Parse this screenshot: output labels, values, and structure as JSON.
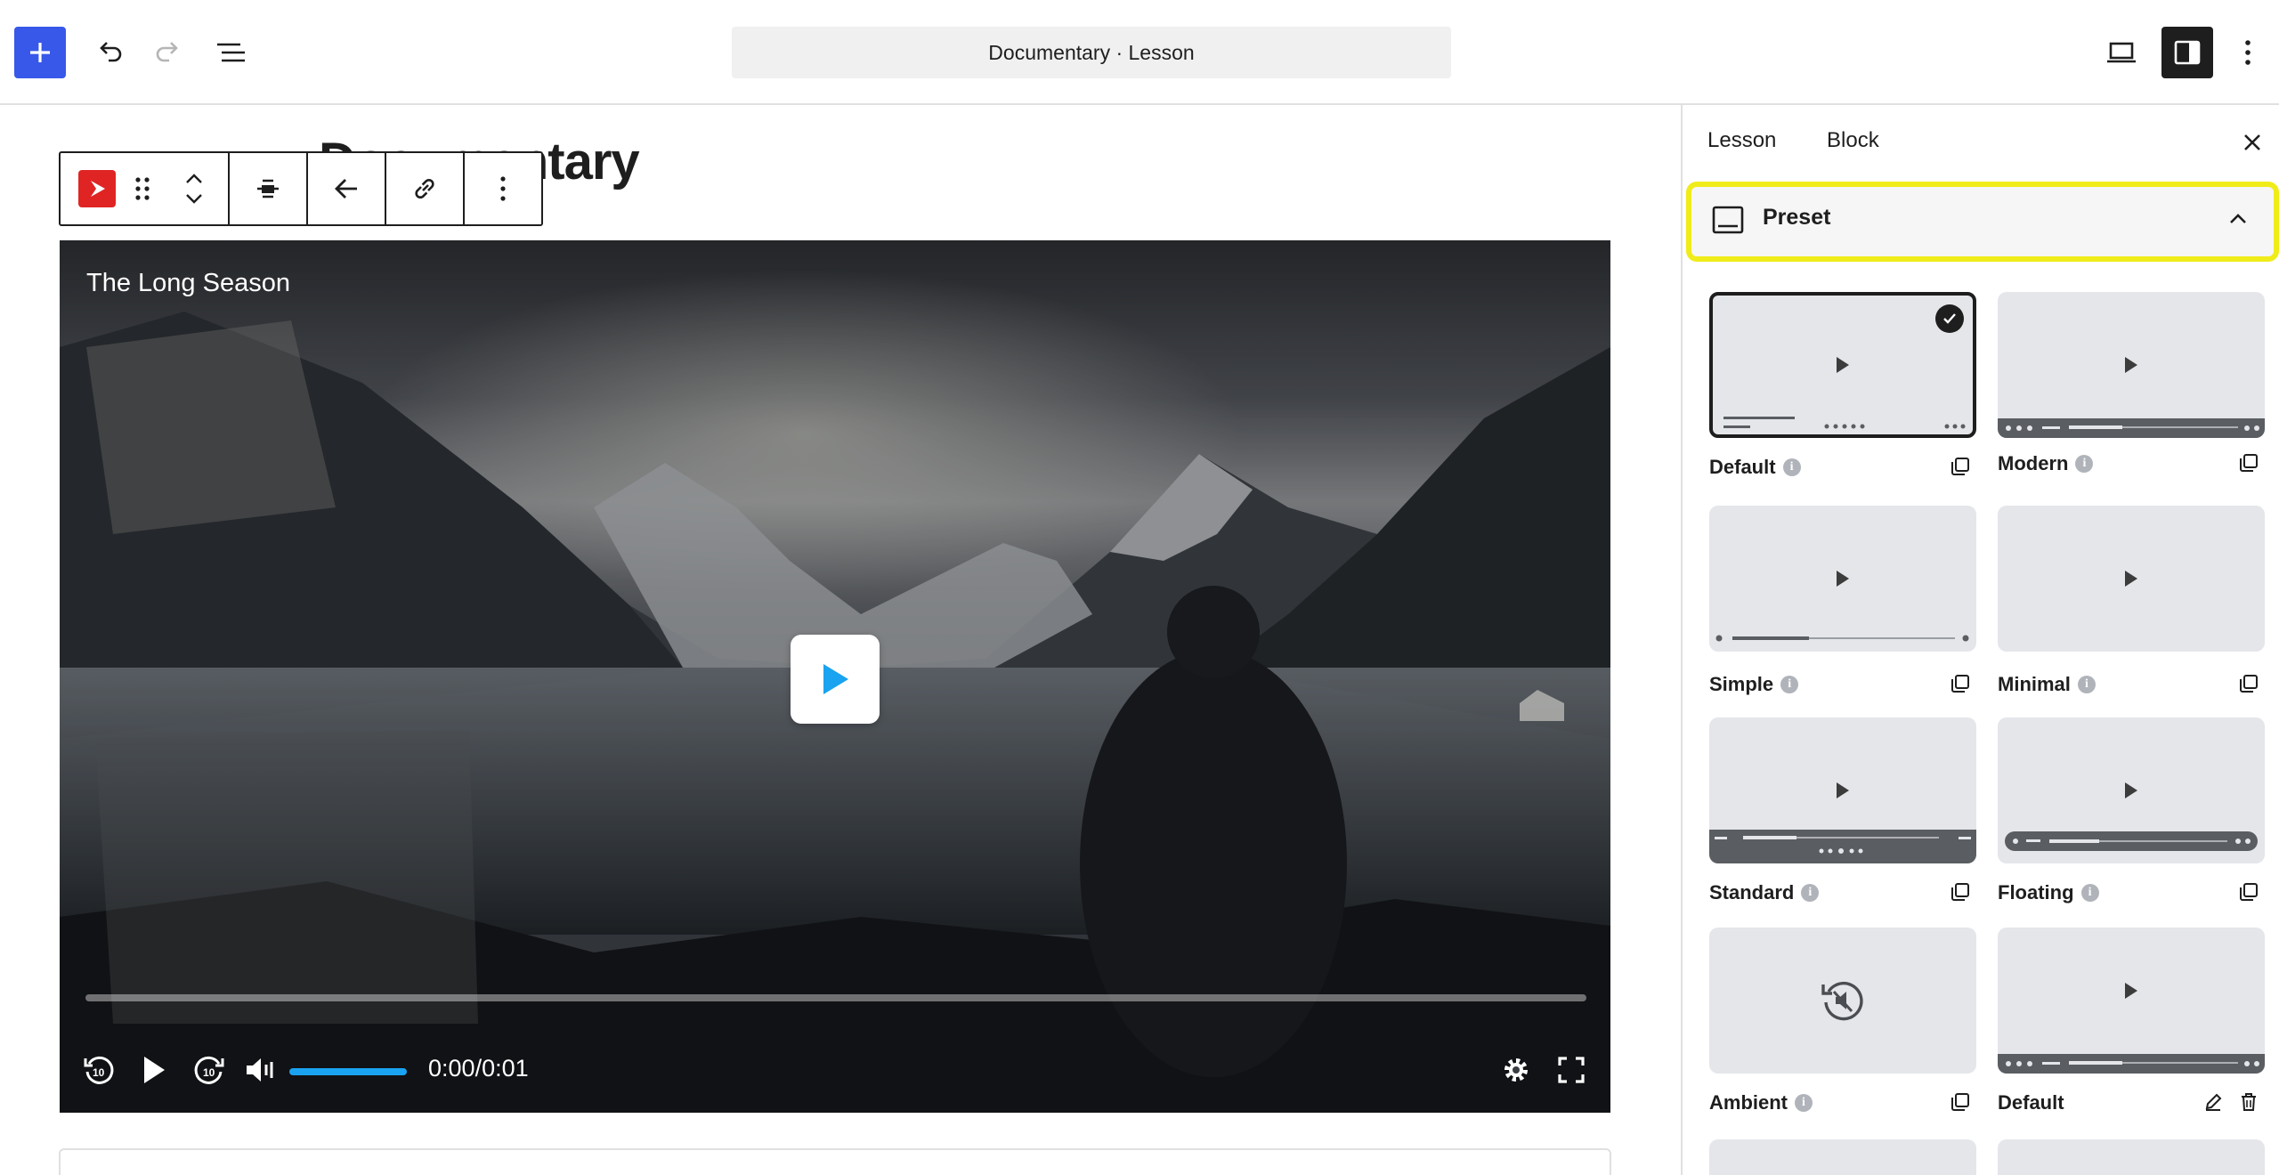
{
  "topbar": {
    "document_title": "Documentary · Lesson",
    "accent_color": "#3858e9"
  },
  "editor": {
    "post_title": "Documentary"
  },
  "video": {
    "title": "The Long Season",
    "current_time": "0:00",
    "time_separator": "/",
    "duration": "0:01",
    "progress": 0,
    "volume": 1.0,
    "accent_color": "#1aa3f0"
  },
  "sidebar": {
    "tabs": [
      "Lesson",
      "Block"
    ],
    "panel_title": "Preset",
    "highlight_color": "#f0ec1a",
    "presets": [
      {
        "label": "Default",
        "selected": true,
        "action": "copy"
      },
      {
        "label": "Modern",
        "selected": false,
        "action": "copy"
      },
      {
        "label": "Simple",
        "selected": false,
        "action": "copy"
      },
      {
        "label": "Minimal",
        "selected": false,
        "action": "copy"
      },
      {
        "label": "Standard",
        "selected": false,
        "action": "copy"
      },
      {
        "label": "Floating",
        "selected": false,
        "action": "copy"
      },
      {
        "label": "Ambient",
        "selected": false,
        "action": "copy"
      },
      {
        "label": "Default",
        "selected": false,
        "action": "edit-delete"
      }
    ]
  }
}
